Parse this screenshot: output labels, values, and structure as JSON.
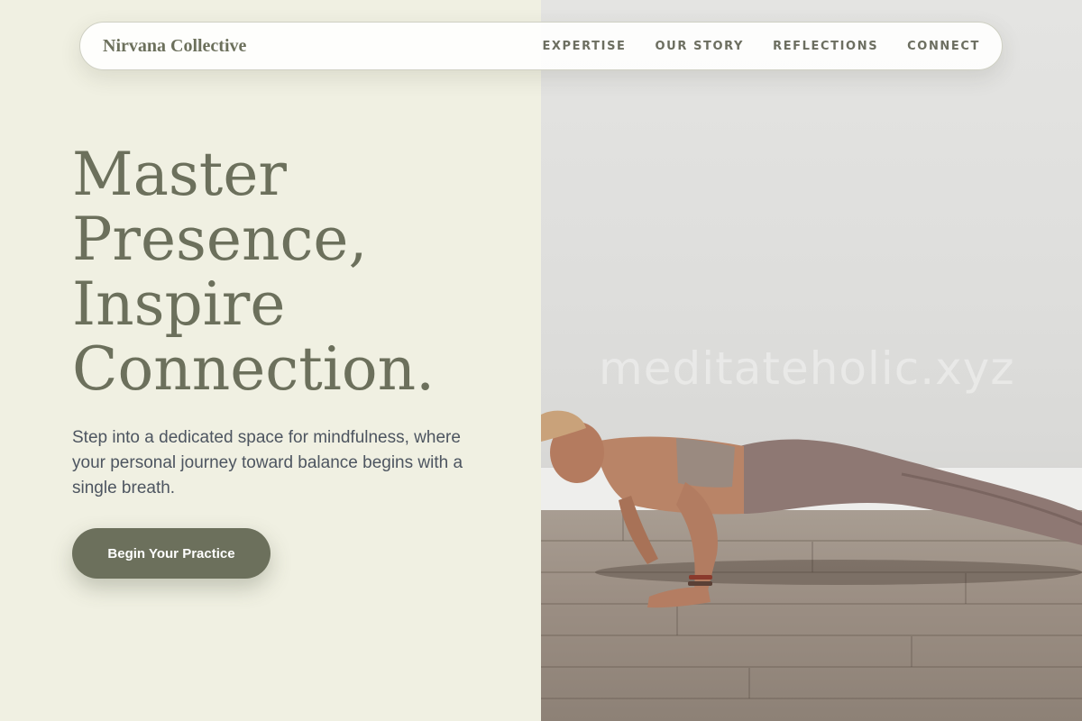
{
  "header": {
    "brand": "Nirvana Collective",
    "nav": [
      "EXPERTISE",
      "OUR STORY",
      "REFLECTIONS",
      "CONNECT"
    ]
  },
  "hero": {
    "title_lines": [
      "Master",
      "Presence,",
      "Inspire",
      "Connection."
    ],
    "subtitle": "Step into a dedicated space for mindfulness, where your personal journey toward balance begins with a single breath.",
    "cta_label": "Begin Your Practice"
  },
  "photo": {
    "watermark": "meditateholic.xyz"
  },
  "colors": {
    "left_background": "#f0f0e2",
    "accent": "#6c705c",
    "body_text": "#4d5560",
    "button_text": "#ffffff"
  }
}
